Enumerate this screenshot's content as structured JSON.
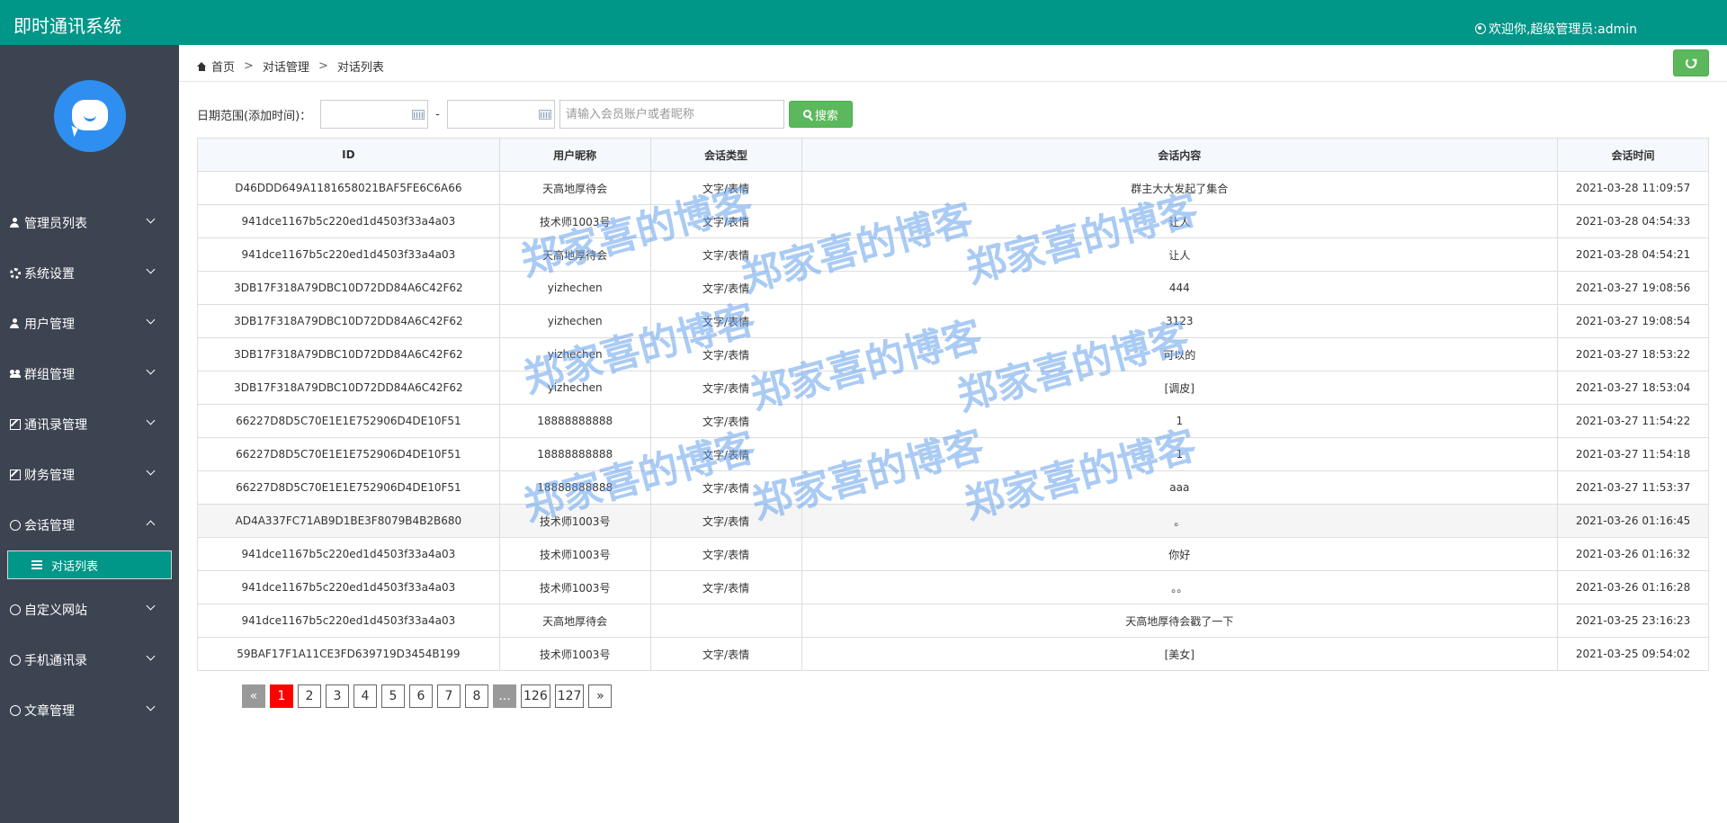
{
  "header": {
    "app_title": "即时通讯系统",
    "welcome_text": "欢迎你,超级管理员:admin"
  },
  "sidebar": {
    "items": [
      {
        "label": "管理员列表",
        "icon": "user-icon",
        "expanded": false
      },
      {
        "label": "系统设置",
        "icon": "gear-icon",
        "expanded": false
      },
      {
        "label": "用户管理",
        "icon": "user-icon",
        "expanded": false
      },
      {
        "label": "群组管理",
        "icon": "group-icon",
        "expanded": false
      },
      {
        "label": "通讯录管理",
        "icon": "edit-icon",
        "expanded": false
      },
      {
        "label": "财务管理",
        "icon": "edit-icon",
        "expanded": false
      },
      {
        "label": "会话管理",
        "icon": "chat-icon",
        "expanded": true
      },
      {
        "label": "自定义网站",
        "icon": "chat-icon",
        "expanded": false
      },
      {
        "label": "手机通讯录",
        "icon": "chat-icon",
        "expanded": false
      },
      {
        "label": "文章管理",
        "icon": "chat-icon",
        "expanded": false
      }
    ],
    "active_subitem": "对话列表"
  },
  "breadcrumb": [
    "首页",
    "对话管理",
    "对话列表"
  ],
  "filter": {
    "date_label": "日期范围(添加时间)：",
    "start_date": "",
    "end_date": "",
    "dash": "-",
    "search_placeholder": "请输入会员账户或者昵称",
    "search_button": "搜索"
  },
  "table": {
    "columns": [
      "ID",
      "用户昵称",
      "会话类型",
      "会话内容",
      "会话时间"
    ],
    "rows": [
      [
        "D46DDD649A1181658021BAF5FE6C6A66",
        "天高地厚待会",
        "文字/表情",
        "群主大大发起了集合",
        "2021-03-28 11:09:57"
      ],
      [
        "941dce1167b5c220ed1d4503f33a4a03",
        "技术师1003号",
        "文字/表情",
        "让人",
        "2021-03-28 04:54:33"
      ],
      [
        "941dce1167b5c220ed1d4503f33a4a03",
        "天高地厚待会",
        "文字/表情",
        "让人",
        "2021-03-28 04:54:21"
      ],
      [
        "3DB17F318A79DBC10D72DD84A6C42F62",
        "yizhechen",
        "文字/表情",
        "444",
        "2021-03-27 19:08:56"
      ],
      [
        "3DB17F318A79DBC10D72DD84A6C42F62",
        "yizhechen",
        "文字/表情",
        "3123",
        "2021-03-27 19:08:54"
      ],
      [
        "3DB17F318A79DBC10D72DD84A6C42F62",
        "yizhechen",
        "文字/表情",
        "可以的",
        "2021-03-27 18:53:22"
      ],
      [
        "3DB17F318A79DBC10D72DD84A6C42F62",
        "yizhechen",
        "文字/表情",
        "[调皮]",
        "2021-03-27 18:53:04"
      ],
      [
        "66227D8D5C70E1E1E752906D4DE10F51",
        "18888888888",
        "文字/表情",
        "1",
        "2021-03-27 11:54:22"
      ],
      [
        "66227D8D5C70E1E1E752906D4DE10F51",
        "18888888888",
        "文字/表情",
        "1",
        "2021-03-27 11:54:18"
      ],
      [
        "66227D8D5C70E1E1E752906D4DE10F51",
        "18888888888",
        "文字/表情",
        "aaa",
        "2021-03-27 11:53:37"
      ],
      [
        "AD4A337FC71AB9D1BE3F8079B4B2B680",
        "技术师1003号",
        "文字/表情",
        "。",
        "2021-03-26 01:16:45"
      ],
      [
        "941dce1167b5c220ed1d4503f33a4a03",
        "技术师1003号",
        "文字/表情",
        "你好",
        "2021-03-26 01:16:32"
      ],
      [
        "941dce1167b5c220ed1d4503f33a4a03",
        "技术师1003号",
        "文字/表情",
        "。。",
        "2021-03-26 01:16:28"
      ],
      [
        "941dce1167b5c220ed1d4503f33a4a03",
        "天高地厚待会",
        "",
        "天高地厚待会戳了一下",
        "2021-03-25 23:16:23"
      ],
      [
        "59BAF17F1A11CE3FD639719D3454B199",
        "技术师1003号",
        "文字/表情",
        "[美女]",
        "2021-03-25 09:54:02"
      ]
    ],
    "highlighted_row": 10
  },
  "pager": {
    "prev": "«",
    "pages": [
      "1",
      "2",
      "3",
      "4",
      "5",
      "6",
      "7",
      "8",
      "...",
      "126",
      "127"
    ],
    "next": "»",
    "current": "1"
  },
  "watermark_text": "郑家喜的博客",
  "colors": {
    "header_bg": "#009688",
    "sidebar_bg": "#3d4451",
    "button_green": "#5cb85c",
    "active_page": "#ff0000"
  }
}
